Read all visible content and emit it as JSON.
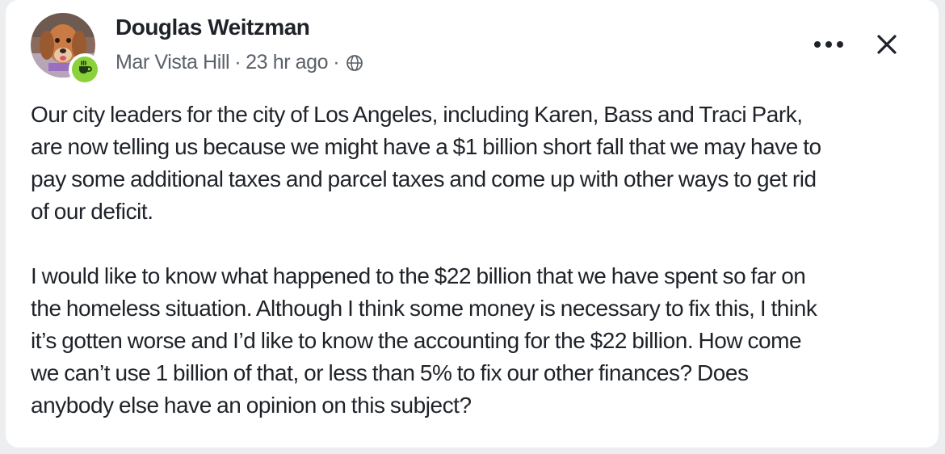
{
  "post": {
    "author": "Douglas Weitzman",
    "neighborhood": "Mar Vista Hill",
    "separator": "·",
    "time": "23 hr ago",
    "visibility_icon": "globe-icon",
    "badge_icon": "coffee-cup-icon",
    "badge_color": "#8bd13a",
    "paragraphs": [
      "Our city leaders for the city of Los Angeles, including Karen, Bass and Traci Park,\nare now telling us because we might have a $1 billion short fall that we may have to\npay some additional taxes and parcel taxes and come up with other ways to get rid\nof our deficit.",
      "I would like to know what happened to the $22 billion that we have spent so far on\nthe homeless situation. Although I think some money is necessary to fix this,  I think\nit’s gotten worse and I’d like to know the accounting for the $22 billion. How come\nwe can’t use 1 billion of that, or less than 5% to fix our other finances? Does\nanybody else have an opinion on this subject?"
    ]
  },
  "actions": {
    "more_icon": "more-horizontal-icon",
    "close_icon": "close-icon"
  }
}
